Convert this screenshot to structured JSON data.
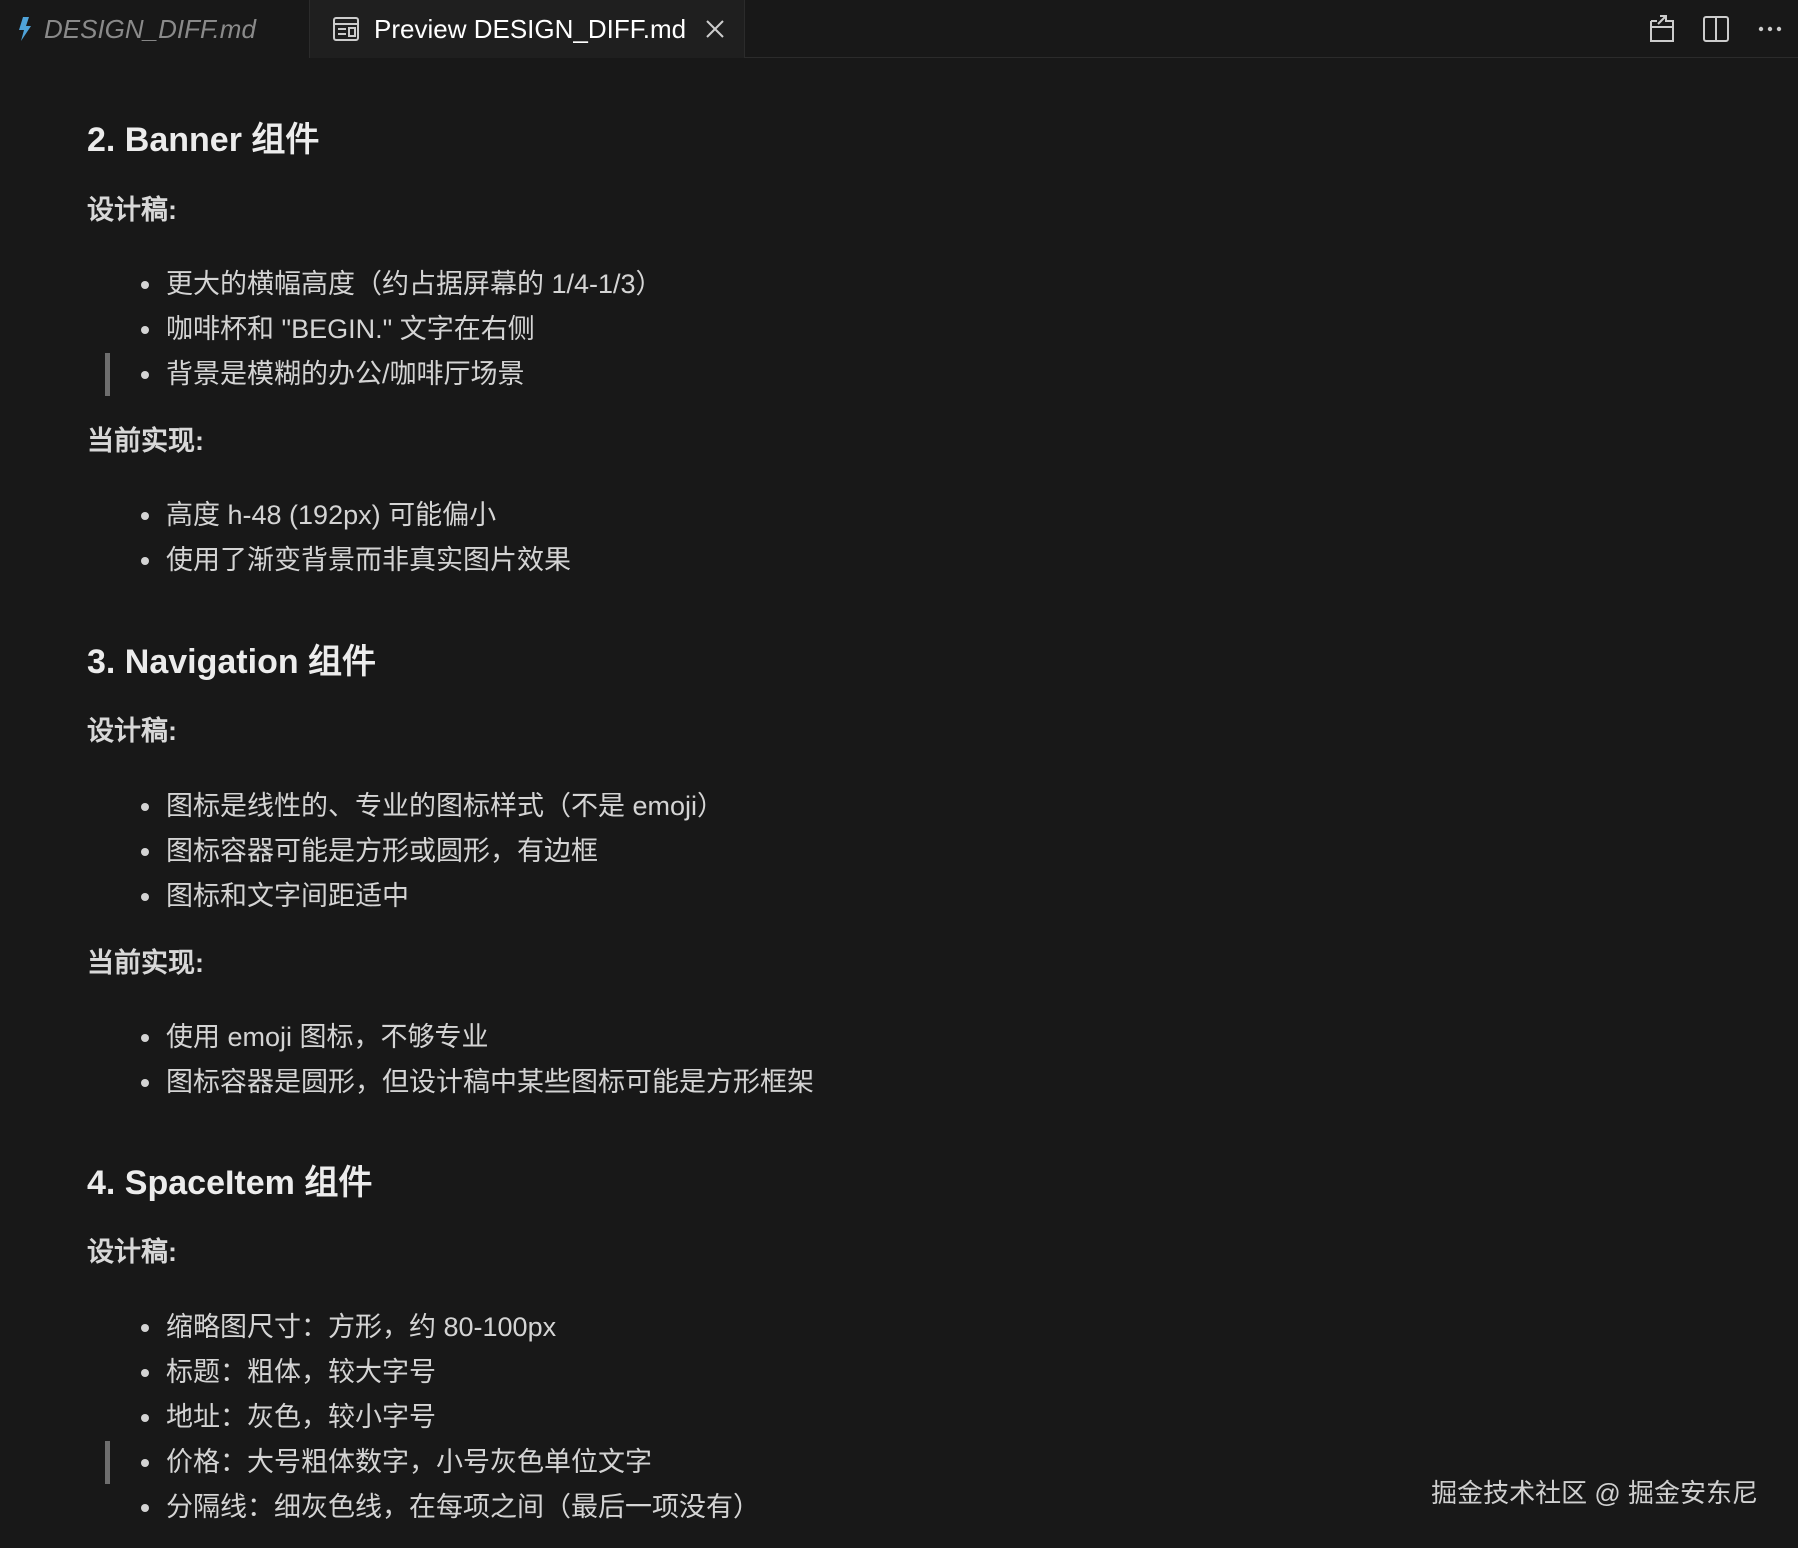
{
  "tabs": {
    "inactive": {
      "label": "DESIGN_DIFF.md",
      "icon": "markdown-icon"
    },
    "active": {
      "label": "Preview DESIGN_DIFF.md",
      "icon": "preview-icon",
      "close_icon": "close-icon"
    }
  },
  "actions": [
    {
      "name": "open-source-icon"
    },
    {
      "name": "split-editor-icon"
    },
    {
      "name": "more-actions-icon"
    }
  ],
  "sections": [
    {
      "heading": "2. Banner 组件",
      "design_label": "设计稿:",
      "design_items": [
        "更大的横幅高度（约占据屏幕的 1/4-1/3）",
        "咖啡杯和 \"BEGIN.\" 文字在右侧",
        "背景是模糊的办公/咖啡厅场景"
      ],
      "current_label": "当前实现:",
      "current_items": [
        "高度 h-48 (192px) 可能偏小",
        "使用了渐变背景而非真实图片效果"
      ]
    },
    {
      "heading": "3. Navigation 组件",
      "design_label": "设计稿:",
      "design_items": [
        "图标是线性的、专业的图标样式（不是 emoji）",
        "图标容器可能是方形或圆形，有边框",
        "图标和文字间距适中"
      ],
      "current_label": "当前实现:",
      "current_items": [
        "使用 emoji 图标，不够专业",
        "图标容器是圆形，但设计稿中某些图标可能是方形框架"
      ]
    },
    {
      "heading": "4. SpaceItem 组件",
      "design_label": "设计稿:",
      "design_items": [
        "缩略图尺寸：方形，约 80-100px",
        "标题：粗体，较大字号",
        "地址：灰色，较小字号",
        "价格：大号粗体数字，小号灰色单位文字",
        "分隔线：细灰色线，在每项之间（最后一项没有）"
      ]
    }
  ],
  "watermark": "掘金技术社区 @ 掘金安东尼",
  "colors": {
    "background": "#181818",
    "active_tab": "#1f1f1f",
    "markdown_icon": "#4fa3d9"
  }
}
